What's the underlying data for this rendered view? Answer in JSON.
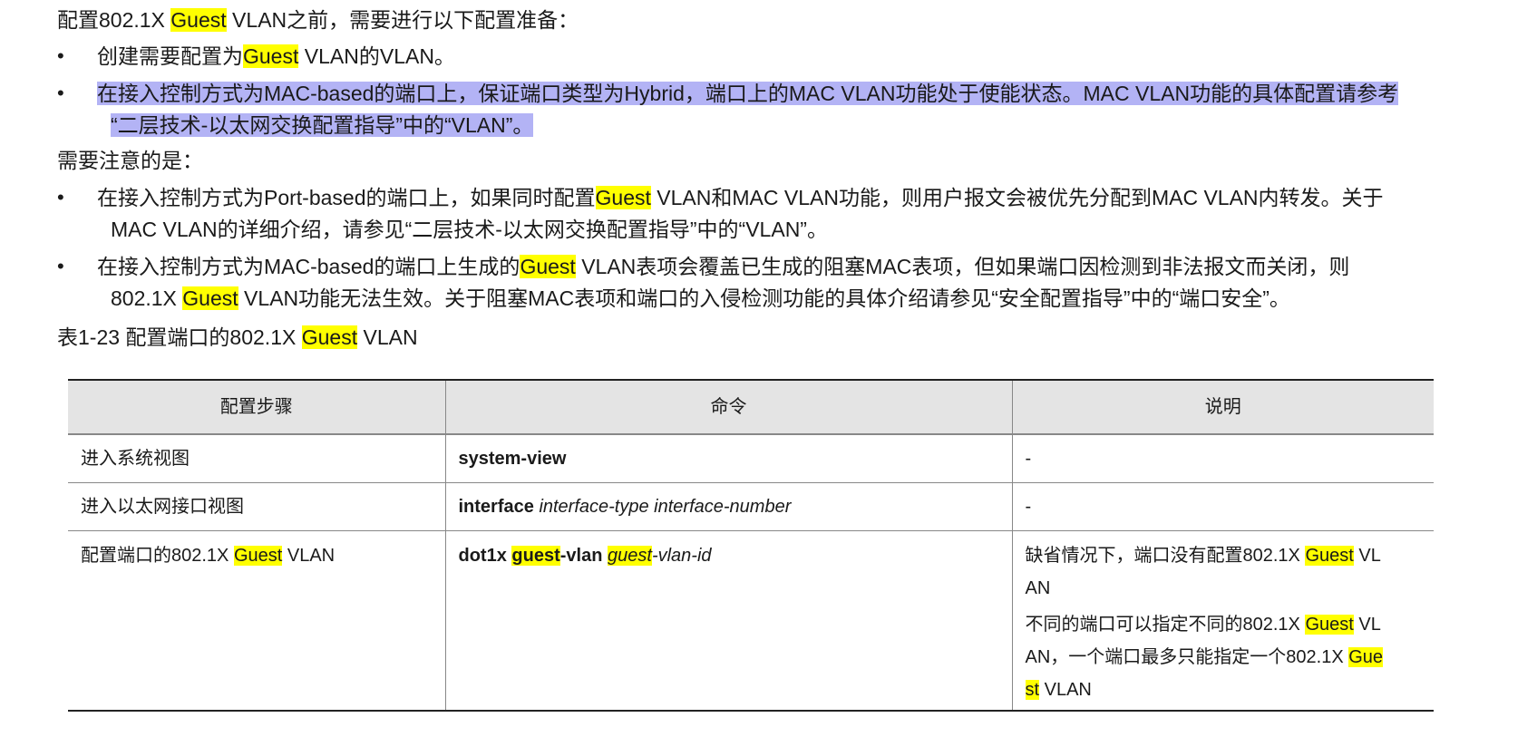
{
  "intro": {
    "prefix": "配置802.1X ",
    "highlight": "Guest",
    "suffix": " VLAN之前，需要进行以下配置准备："
  },
  "prep_items": [
    {
      "a": "创建需要配置为",
      "hl": "Guest",
      "b": " VLAN的VLAN。"
    },
    {
      "line1": "在接入控制方式为MAC-based的端口上，保证端口类型为Hybrid，端口上的MAC VLAN功能处于使能状态。MAC VLAN功能的具体配置请参考",
      "line2": "“二层技术-以太网交换配置指导”中的“VLAN”。"
    }
  ],
  "notes_heading": "需要注意的是：",
  "note_items": [
    {
      "l1a": "在接入控制方式为Port-based的端口上，如果同时配置",
      "l1hl": "Guest",
      "l1b": " VLAN和MAC VLAN功能，则用户报文会被优先分配到MAC VLAN内转发。关于",
      "l2": "MAC VLAN的详细介绍，请参见“二层技术-以太网交换配置指导”中的“VLAN”。"
    },
    {
      "l1a": "在接入控制方式为MAC-based的端口上生成的",
      "l1hl": "Guest",
      "l1b": " VLAN表项会覆盖已生成的阻塞MAC表项，但如果端口因检测到非法报文而关闭，则",
      "l2a": "802.1X ",
      "l2hl": "Guest",
      "l2b": " VLAN功能无法生效。关于阻塞MAC表项和端口的入侵检测功能的具体介绍请参见“安全配置指导”中的“端口安全”。"
    }
  ],
  "table_caption": {
    "prefix": "表1-23 配置端口的802.1X ",
    "hl": "Guest",
    "suffix": " VLAN"
  },
  "table": {
    "headers": [
      "配置步骤",
      "命令",
      "说明"
    ],
    "rows": [
      {
        "step": "进入系统视图",
        "cmd_bold": "system-view",
        "desc": "-"
      },
      {
        "step": "进入以太网接口视图",
        "cmd_bold": "interface",
        "cmd_italic": "interface-type interface-number",
        "desc": "-"
      },
      {
        "step_a": "配置端口的802.1X ",
        "step_hl": "Guest",
        "step_b": " VLAN",
        "cmd_b1": "dot1x ",
        "cmd_hl_b": "guest",
        "cmd_b2": "-vlan ",
        "cmd_hl_i": "guest",
        "cmd_i": "-vlan-id",
        "desc1_a": "缺省情况下，端口没有配置802.1X ",
        "desc1_hl": "Guest",
        "desc1_b": " VL",
        "desc1_c": "AN",
        "desc2_a": "不同的端口可以指定不同的802.1X ",
        "desc2_hl": "Guest",
        "desc2_b": " VL",
        "desc2_c": "AN，一个端口最多只能指定一个802.1X ",
        "desc2_hl2": "Gue",
        "desc2_hl3": "st",
        "desc2_d": " VLAN"
      }
    ]
  },
  "colors": {
    "highlight": "#ffff00",
    "selection": "#b3b3f5",
    "header_bg": "#e4e4e4"
  }
}
